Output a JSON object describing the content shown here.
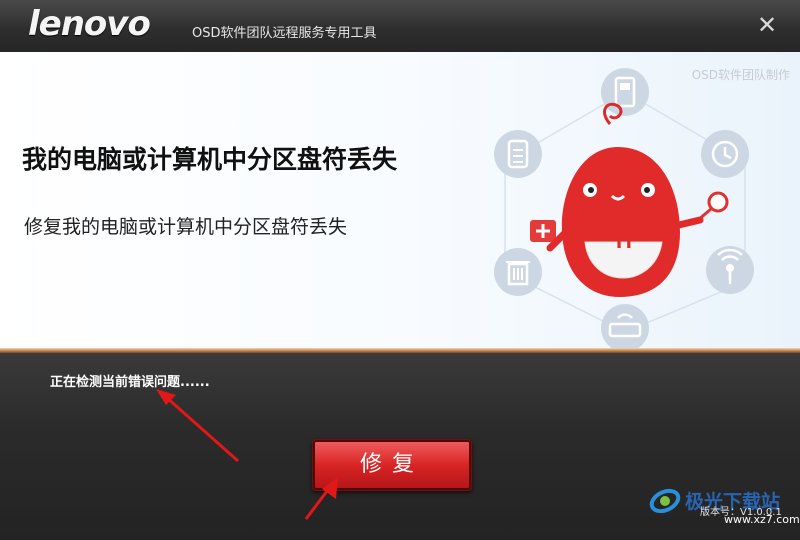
{
  "header": {
    "logo": "lenovo",
    "title": "OSD软件团队远程服务专用工具",
    "close_glyph": "✕"
  },
  "banner": {
    "credit": "OSD软件团队制作",
    "title": "我的电脑或计算机中分区盘符丢失",
    "subtitle": "修复我的电脑或计算机中分区盘符丢失",
    "mascot_letter": "H",
    "icons": [
      "phone-icon",
      "clock-icon",
      "search-icon",
      "wifi-icon",
      "router-icon",
      "trash-icon",
      "first-aid-icon",
      "document-icon"
    ]
  },
  "status": {
    "text": "正在检测当前错误问题......"
  },
  "actions": {
    "repair_label": "修复"
  },
  "footer": {
    "version": "版本号：V1.0.0.1"
  },
  "watermark": {
    "name": "极光下载站",
    "site": "www.xz7.com"
  },
  "colors": {
    "accent_red": "#d82424",
    "titlebar": "#2e2e2e",
    "annotation": "#e01818"
  }
}
